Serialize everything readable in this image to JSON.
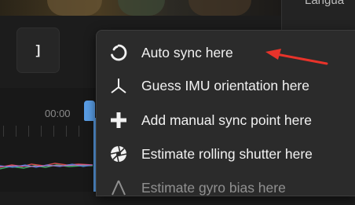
{
  "top_right": {
    "label": "Langua"
  },
  "toolbar": {
    "bracket_label": "]"
  },
  "timeline": {
    "time_label": "00:00"
  },
  "context_menu": {
    "items": [
      {
        "label": "Auto sync here",
        "icon": "auto-sync-icon"
      },
      {
        "label": "Guess IMU orientation here",
        "icon": "imu-axes-icon"
      },
      {
        "label": "Add manual sync point here",
        "icon": "plus-icon"
      },
      {
        "label": "Estimate rolling shutter here",
        "icon": "shutter-icon"
      },
      {
        "label": "Estimate gyro bias here",
        "icon": "gyro-bias-icon"
      }
    ]
  },
  "annotation": {
    "arrow_color": "#e8332a"
  },
  "colors": {
    "playhead": "#5a9ee6",
    "menu_bg": "#2b2b2b"
  }
}
